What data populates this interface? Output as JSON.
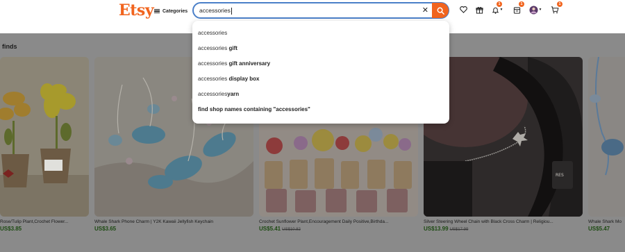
{
  "header": {
    "logo": "Etsy",
    "categories_label": "Categories",
    "search_value": "accessories",
    "icons": [
      "heart-icon",
      "gift-icon",
      "bell-icon",
      "store-icon",
      "avatar",
      "cart-icon"
    ],
    "badges": {
      "notifications": "1",
      "shop": "1",
      "cart": "1"
    },
    "accent_color": "#F1641E"
  },
  "main": {
    "section_title": "finds",
    "cards": [
      {
        "title": "Rose/Tulip Plant,Crochet Flower...",
        "price": "US$3.85",
        "old_price": ""
      },
      {
        "title": "Whale Shark Phone Charm | Y2K Kawaii Jellyfish Keychain",
        "price": "US$3.65",
        "old_price": ""
      },
      {
        "title": "Crochet Sunflower Plant,Encouragement Daily Positive,Birthda...",
        "price": "US$5.41",
        "old_price": "US$10.82"
      },
      {
        "title": "Silver Steering Wheel Chain with Black Cross Charm | Religiou...",
        "price": "US$13.99",
        "old_price": "US$17.99"
      },
      {
        "title": "Whale Shark Mo",
        "price": "US$5.47",
        "old_price": ""
      }
    ]
  },
  "dropdown": {
    "suggestions": [
      {
        "prefix": "accessories",
        "suffix": ""
      },
      {
        "prefix": "accessories ",
        "suffix": "gift"
      },
      {
        "prefix": "accessories ",
        "suffix": "gift anniversary"
      },
      {
        "prefix": "accessories ",
        "suffix": "display box"
      },
      {
        "prefix": "accessories",
        "suffix": "yarn"
      }
    ],
    "shop_search": "find shop names containing \"accessories\""
  }
}
